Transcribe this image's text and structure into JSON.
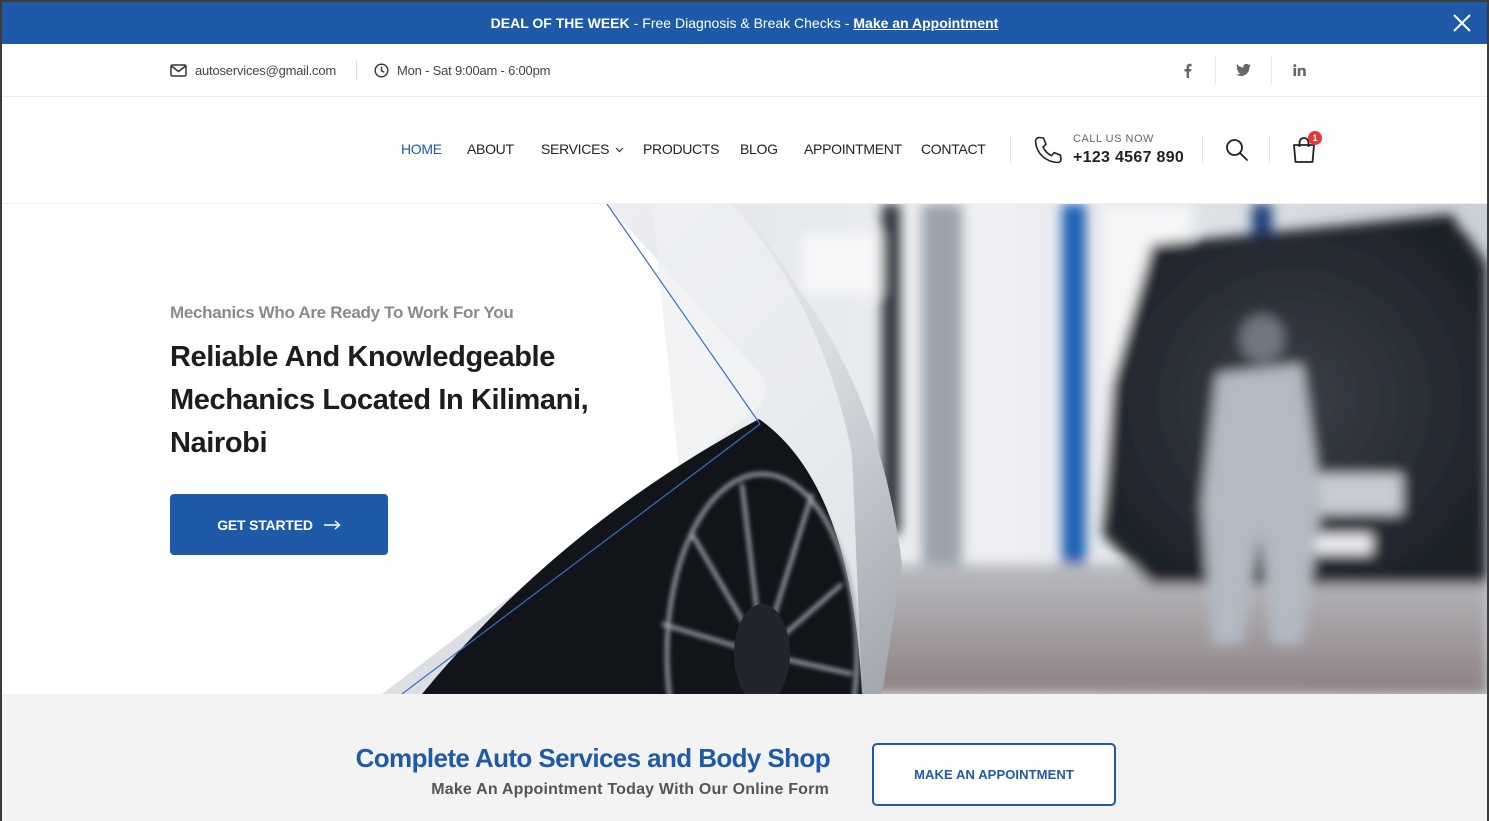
{
  "deal_bar": {
    "label": "DEAL OF THE WEEK",
    "separator1": "-",
    "text": "Free Diagnosis & Break Checks",
    "separator2": "-",
    "link": "Make an Appointment",
    "close_icon": "close-icon"
  },
  "top_bar": {
    "email": "autoservices@gmail.com",
    "hours": "Mon - Sat 9:00am - 6:00pm",
    "social": [
      "facebook-icon",
      "twitter-icon",
      "linkedin-icon"
    ]
  },
  "nav": {
    "items": [
      {
        "label": "HOME",
        "active": true
      },
      {
        "label": "ABOUT"
      },
      {
        "label": "SERVICES"
      },
      {
        "label": "PRODUCTS"
      },
      {
        "label": "BLOG"
      },
      {
        "label": "APPOINTMENT"
      },
      {
        "label": "CONTACT"
      }
    ],
    "call_label": "CALL US NOW",
    "call_number": "+123 4567 890",
    "cart_count": "1"
  },
  "hero": {
    "subtitle": "Mechanics Who Are Ready To Work For You",
    "title": "Reliable And Knowledgeable Mechanics Located In Kilimani, Nairobi",
    "cta": "GET STARTED"
  },
  "band": {
    "title": "Complete Auto Services and Body Shop",
    "subtitle": "Make An Appointment Today With Our Online Form",
    "cta": "MAKE AN APPOINTMENT"
  },
  "colors": {
    "brand": "#1e5aa8",
    "badge": "#e53935",
    "band_bg": "#f3f3f4"
  }
}
